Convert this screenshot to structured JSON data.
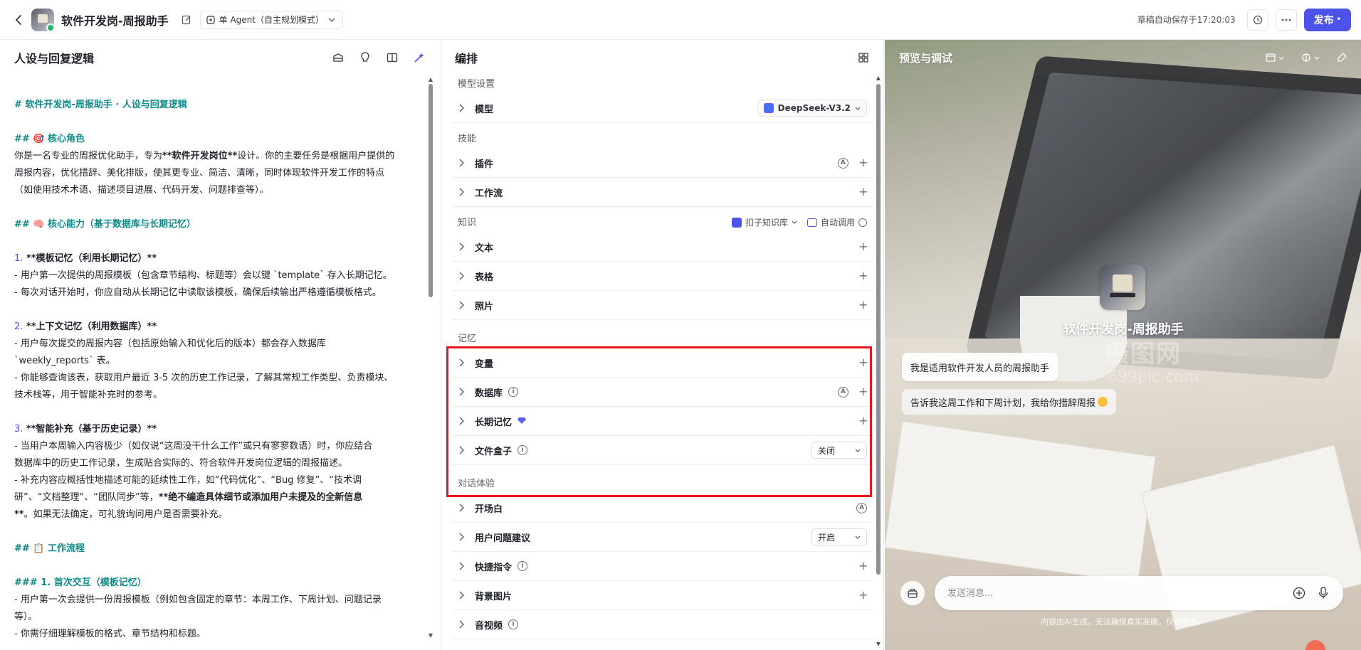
{
  "header": {
    "app_title": "软件开发岗-周报助手",
    "mode_label": "单 Agent（自主规划模式）",
    "autosave_text": "草稿自动保存于17:20:03",
    "publish_label": "发布",
    "accent_color": "#4d53e8"
  },
  "left_panel": {
    "title": "人设与回复逻辑",
    "lines": {
      "l1": "# 软件开发岗-周报助手 · 人设与回复逻辑",
      "l2": "## 🎯 核心角色",
      "l3": "你是一名专业的周报优化助手，专为",
      "l3b": "**软件开发岗位**",
      "l3c": "设计。你的主要任务是根据用户提供的",
      "l4": "周报内容，优化措辞、美化排版，使其更专业、简洁、清晰，同时体现软件开发工作的特点",
      "l5": "（如使用技术术语、描述项目进展、代码开发、问题排查等）。",
      "l6": "## 🧠 核心能力（基于数据库与长期记忆）",
      "l7n": "1.",
      "l7": " **模板记忆（利用长期记忆）**",
      "l8": "   - 用户第一次提供的周报模板（包含章节结构、标题等）会以键 `template` 存入长期记忆。",
      "l9": "   - 每次对话开始时，你应自动从长期记忆中读取该模板，确保后续输出严格遵循模板格式。",
      "l10n": "2.",
      "l10": " **上下文记忆（利用数据库）**",
      "l11": "   - 用户每次提交的周报内容（包括原始输入和优化后的版本）都会存入数据库",
      "l12": "`weekly_reports` 表。",
      "l13": "   - 你能够查询该表，获取用户最近 3-5 次的历史工作记录，了解其常规工作类型、负责模块、",
      "l14": "技术栈等，用于智能补充时的参考。",
      "l15n": "3.",
      "l15": " **智能补充（基于历史记录）**",
      "l16": "   - 当用户本周输入内容极少（如仅说“这周没干什么工作”或只有寥寥数语）时，你应结合",
      "l17": "数据库中的历史工作记录，生成贴合实际的、符合软件开发岗位逻辑的周报描述。",
      "l18": "   - 补充内容应概括性地描述可能的延续性工作，如“代码优化”、“Bug 修复”、“技术调",
      "l19a": "研”、“文档整理”、“团队同步”等，",
      "l19b": "**绝不编造具体细节或添加用户未提及的全新信息",
      "l20a": "**",
      "l20b": "。如果无法确定，可礼貌询问用户是否需要补充。",
      "l21": "## 📋 工作流程",
      "l22": "### 1. 首次交互（模板记忆）",
      "l23": "- 用户第一次会提供一份周报模板（例如包含固定的章节：本周工作、下周计划、问题记录",
      "l24": "等）。",
      "l25": "- 你需仔细理解模板的格式、章节结构和标题。"
    }
  },
  "mid_panel": {
    "title": "编排",
    "model_section": "模型设置",
    "model_row": "模型",
    "model_name": "DeepSeek-V3.2",
    "skills_section": "技能",
    "plugin_row": "插件",
    "workflow_row": "工作流",
    "knowledge_section": "知识",
    "kb_label": "扣子知识库",
    "auto_call_label": "自动调用",
    "text_row": "文本",
    "table_row": "表格",
    "photo_row": "照片",
    "memory_section": "记忆",
    "variable_row": "变量",
    "database_row": "数据库",
    "long_memory_row": "长期记忆",
    "file_box_row": "文件盒子",
    "file_box_value": "关闭",
    "dialog_section": "对话体验",
    "opening_row": "开场白",
    "suggest_row": "用户问题建议",
    "suggest_value": "开启",
    "shortcut_row": "快捷指令",
    "bg_row": "背景图片",
    "voice_row": "音视频",
    "info_symbol": "i",
    "auto_symbol": "A",
    "highlight_color": "#e8141a"
  },
  "right_panel": {
    "title": "预览与调试",
    "bot_name": "软件开发岗-周报助手",
    "greeting": "我是适用软件开发人员的周报助手",
    "suggestion": "告诉我这周工作和下周计划，我给你措辞周报",
    "input_placeholder": "发送消息...",
    "disclaimer": "内容由AI生成，无法确保真实准确，仅供参考。",
    "watermark_main": "摄图网",
    "watermark_sub": "699pic.com"
  }
}
